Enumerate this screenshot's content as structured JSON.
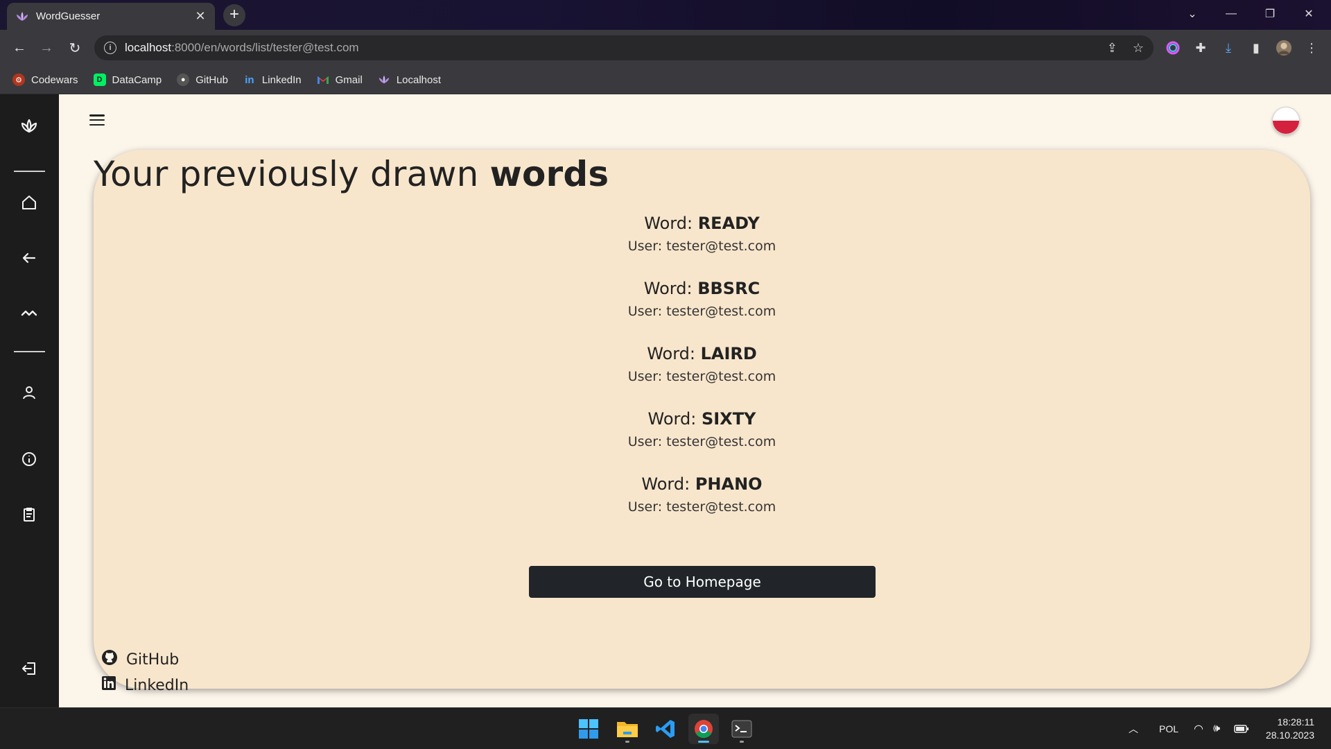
{
  "browser": {
    "tab_title": "WordGuesser",
    "url_host": "localhost",
    "url_path": ":8000/en/words/list/tester@test.com",
    "bookmarks": [
      {
        "label": "Codewars",
        "icon": "codewars-icon",
        "color": "#b1361e"
      },
      {
        "label": "DataCamp",
        "icon": "datacamp-icon",
        "color": "#03ef62"
      },
      {
        "label": "GitHub",
        "icon": "github-icon",
        "color": "#2b2b2b"
      },
      {
        "label": "LinkedIn",
        "icon": "linkedin-icon",
        "color": "#0a66c2"
      },
      {
        "label": "Gmail",
        "icon": "gmail-icon",
        "color": "#ea4335"
      },
      {
        "label": "Localhost",
        "icon": "lotus-icon",
        "color": "#b58be0"
      }
    ]
  },
  "page": {
    "heading_prefix": "Your previously drawn",
    "heading_bold": "words",
    "word_label": "Word:",
    "user_label": "User:",
    "entries": [
      {
        "word": "READY",
        "user": "tester@test.com"
      },
      {
        "word": "BBSRC",
        "user": "tester@test.com"
      },
      {
        "word": "LAIRD",
        "user": "tester@test.com"
      },
      {
        "word": "SIXTY",
        "user": "tester@test.com"
      },
      {
        "word": "PHANO",
        "user": "tester@test.com"
      }
    ],
    "home_button": "Go to Homepage",
    "footer_links": [
      {
        "label": "GitHub",
        "icon": "github-icon"
      },
      {
        "label": "LinkedIn",
        "icon": "linkedin-icon"
      }
    ],
    "language_flag": "poland-flag-icon"
  },
  "sidebar": {
    "icons": [
      "lotus-logo-icon",
      "home-icon",
      "back-arrow-icon",
      "stats-icon",
      "user-icon",
      "info-icon",
      "clipboard-icon",
      "logout-icon"
    ]
  },
  "taskbar": {
    "language": "POL",
    "time": "18:28:11",
    "date": "28.10.2023"
  }
}
